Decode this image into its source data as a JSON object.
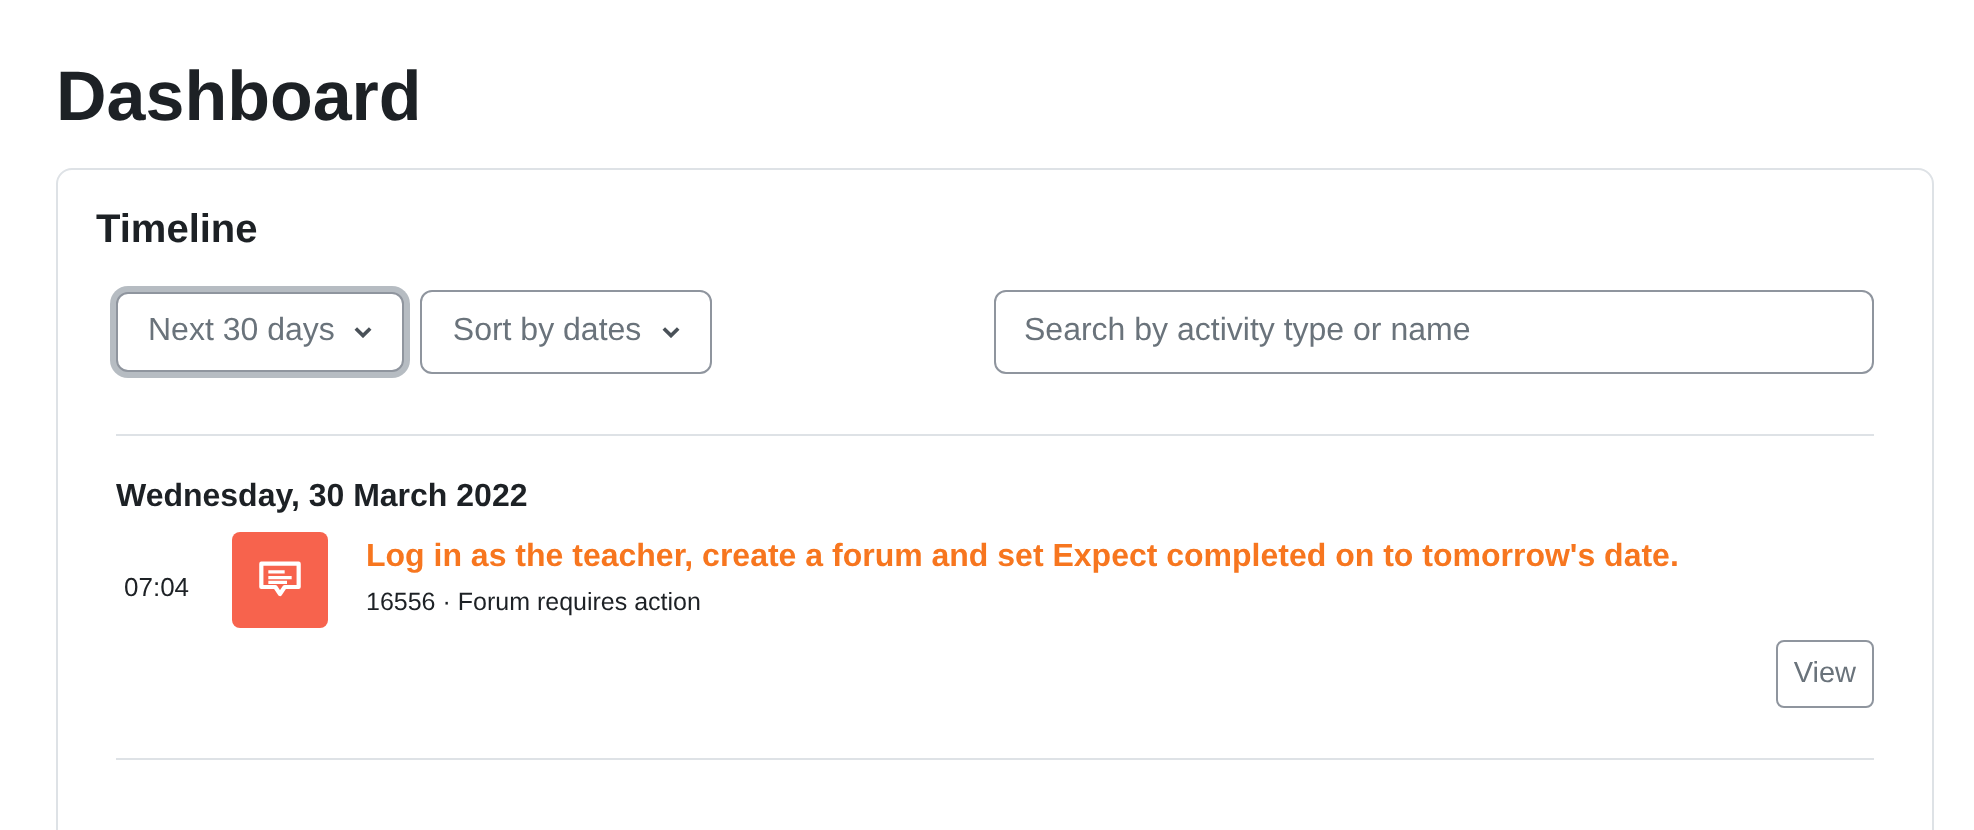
{
  "page_title": "Dashboard",
  "timeline": {
    "title": "Timeline",
    "filters": [
      {
        "label": "Next 30 days",
        "focused": true
      },
      {
        "label": "Sort by dates",
        "focused": false
      }
    ],
    "search": {
      "placeholder": "Search by activity type or name"
    },
    "days": [
      {
        "date": "Wednesday, 30 March 2022",
        "events": [
          {
            "time": "07:04",
            "kind": "forum",
            "title": "Log in as the teacher, create a forum and set Expect completed on to tomorrow's date.",
            "detail": "16556 · Forum requires action",
            "action": "View"
          }
        ]
      }
    ]
  }
}
